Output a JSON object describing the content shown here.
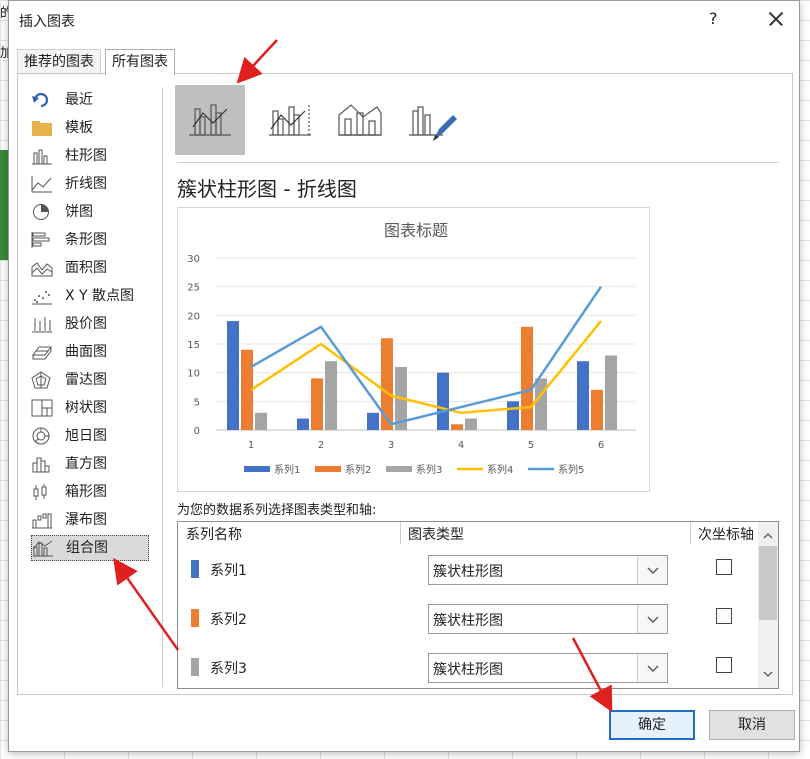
{
  "background": {
    "frag1": "的",
    "frag2": "加"
  },
  "dialog": {
    "title": "插入图表",
    "help": "?"
  },
  "tabs": [
    {
      "label": "推荐的图表"
    },
    {
      "label": "所有图表"
    }
  ],
  "nav": [
    {
      "label": "最近",
      "icon": "undo-icon"
    },
    {
      "label": "模板",
      "icon": "folder-icon"
    },
    {
      "label": "柱形图",
      "icon": "column-chart-icon"
    },
    {
      "label": "折线图",
      "icon": "line-chart-icon"
    },
    {
      "label": "饼图",
      "icon": "pie-chart-icon"
    },
    {
      "label": "条形图",
      "icon": "bar-chart-icon"
    },
    {
      "label": "面积图",
      "icon": "area-chart-icon"
    },
    {
      "label": "X Y 散点图",
      "icon": "scatter-chart-icon"
    },
    {
      "label": "股价图",
      "icon": "stock-chart-icon"
    },
    {
      "label": "曲面图",
      "icon": "surface-chart-icon"
    },
    {
      "label": "雷达图",
      "icon": "radar-chart-icon"
    },
    {
      "label": "树状图",
      "icon": "treemap-icon"
    },
    {
      "label": "旭日图",
      "icon": "sunburst-icon"
    },
    {
      "label": "直方图",
      "icon": "histogram-icon"
    },
    {
      "label": "箱形图",
      "icon": "box-whisker-icon"
    },
    {
      "label": "瀑布图",
      "icon": "waterfall-icon"
    },
    {
      "label": "组合图",
      "icon": "combo-chart-icon",
      "selected": true
    }
  ],
  "chart_heading": "簇状柱形图 - 折线图",
  "chart_data": {
    "type": "bar",
    "title": "图表标题",
    "categories": [
      "1",
      "2",
      "3",
      "4",
      "5",
      "6"
    ],
    "ylim": [
      0,
      30
    ],
    "yticks": [
      "0",
      "5",
      "10",
      "15",
      "20",
      "25",
      "30"
    ],
    "grid": true,
    "legend": "bottom",
    "series": [
      {
        "name": "系列1",
        "kind": "bar",
        "color": "#4472c4",
        "values": [
          19,
          2,
          3,
          10,
          5,
          12
        ]
      },
      {
        "name": "系列2",
        "kind": "bar",
        "color": "#ed7d31",
        "values": [
          14,
          9,
          16,
          1,
          18,
          7
        ]
      },
      {
        "name": "系列3",
        "kind": "bar",
        "color": "#a5a5a5",
        "values": [
          3,
          12,
          11,
          2,
          9,
          13
        ]
      },
      {
        "name": "系列4",
        "kind": "line",
        "color": "#ffc000",
        "values": [
          7,
          15,
          6,
          3,
          4,
          19
        ]
      },
      {
        "name": "系列5",
        "kind": "line",
        "color": "#5b9bd5",
        "values": [
          11,
          18,
          1,
          4,
          7,
          25
        ]
      }
    ]
  },
  "series_table": {
    "label": "为您的数据系列选择图表类型和轴:",
    "headers": {
      "name": "系列名称",
      "type": "图表类型",
      "secondary": "次坐标轴"
    },
    "rows": [
      {
        "name": "系列1",
        "type": "簇状柱形图",
        "color": "#4472c4"
      },
      {
        "name": "系列2",
        "type": "簇状柱形图",
        "color": "#ed7d31"
      },
      {
        "name": "系列3",
        "type": "簇状柱形图",
        "color": "#a5a5a5"
      }
    ]
  },
  "buttons": {
    "ok": "确定",
    "cancel": "取消"
  }
}
